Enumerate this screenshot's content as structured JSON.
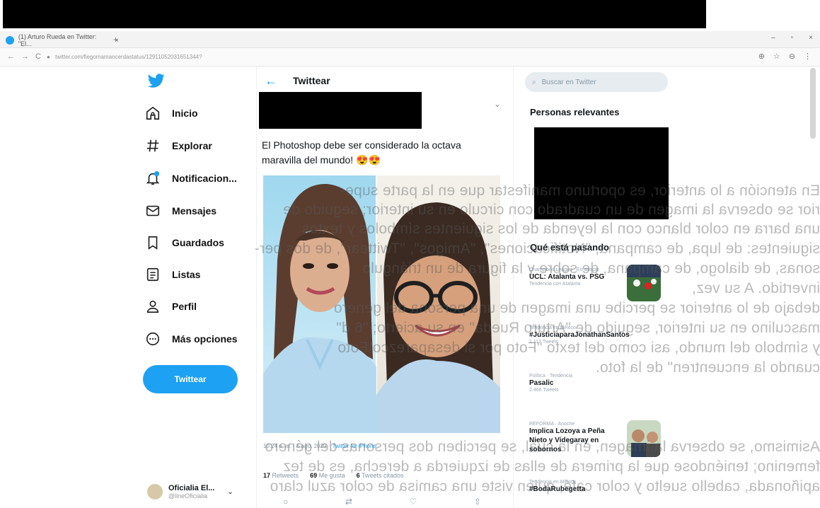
{
  "browser": {
    "tab_title": "(1) Arturo Rueda en Twitter: \"El...",
    "tab_close": "×",
    "tab_new": "+",
    "url": "twitter.com/fiegomamancerdastatus/12911052031651344?",
    "window_controls": [
      "–",
      "▫",
      "×"
    ]
  },
  "nav": {
    "items": [
      {
        "label": "Inicio",
        "icon": "home-icon"
      },
      {
        "label": "Explorar",
        "icon": "hashtag-icon"
      },
      {
        "label": "Notificacion...",
        "icon": "bell-icon"
      },
      {
        "label": "Mensajes",
        "icon": "envelope-icon"
      },
      {
        "label": "Guardados",
        "icon": "bookmark-icon"
      },
      {
        "label": "Listas",
        "icon": "list-icon"
      },
      {
        "label": "Perfil",
        "icon": "person-icon"
      },
      {
        "label": "Más opciones",
        "icon": "more-icon"
      }
    ],
    "tweet_button": "Twittear",
    "account": {
      "name": "Oficialia El...",
      "handle": "@lineOficialia"
    }
  },
  "tweet": {
    "header_title": "Twittear",
    "text": "El Photoshop debe ser considerado la octava maravilla del mundo! 😍😍",
    "meta_time": "10:24 p. m. · 5 ago. 2020",
    "meta_source": "Twitter for iPhone",
    "stats": [
      {
        "count": "17",
        "label": "Retweets"
      },
      {
        "count": "69",
        "label": "Me gusta"
      },
      {
        "count": "6",
        "label": "Tweets citados"
      }
    ]
  },
  "sidebar": {
    "search_placeholder": "Buscar en Twitter",
    "people_title": "Personas relevantes",
    "trends_title": "Qué está pasando",
    "trends": [
      {
        "category": "Champions League · En directo",
        "title": "UCL: Atalanta vs. PSG",
        "count": "Tendencia con Atalanta"
      },
      {
        "category": "Tendencia en México",
        "title": "#JusticiaparaJonathanSantos",
        "count": "1.117 Tweets"
      },
      {
        "category": "Política · Tendencia",
        "title": "Pasalic",
        "count": "2.466 Tweets"
      },
      {
        "category": "REFORMA · Anoche",
        "title": "Implica Lozoya a Peña Nieto y Videgaray en sobornos",
        "count": ""
      },
      {
        "category": "Tendencia en México",
        "title": "#BodaRubegetta",
        "count": ""
      }
    ]
  },
  "scan_overlay": [
    "En atención a lo anterior, es oportuno manifestar que en la parte supe-",
    "rior se observa la imagen de un cuadrado con circulo en su interior; seguido de",
    "una barra en color blanco con la leyenda de los siguientes símbolos y textos",
    "siguientes: de lupa, de campana, \"Notificaciones\", \"Amigos\", \"Twittear\", de dos per-",
    "sonas, de dialogo, de campana, de sobre y la figura de un triángulo",
    "invertido. A su vez,",
    "debajo de lo anterior se percibe una imagen de una persona del genero",
    "masculino en su interior, seguido de \"Arturo Rueda\" en su acierto; \"6 d\"",
    "y símbolo del mundo, asi como del texto \"Foto por si desaparezco\\Foto",
    "cuando la encuentren\" de la foto.",
    "Asimismo, se observa la imagen, en la cual, se perciben dos personas del género",
    "femenino; teniéndose que la primera de ellas de izquierda a derecha, es de tez",
    "apiñonada, cabello suelto y color café, quien viste una camisa de color azul claro"
  ],
  "colors": {
    "accent": "#1da1f2",
    "redaction": "#000000"
  }
}
